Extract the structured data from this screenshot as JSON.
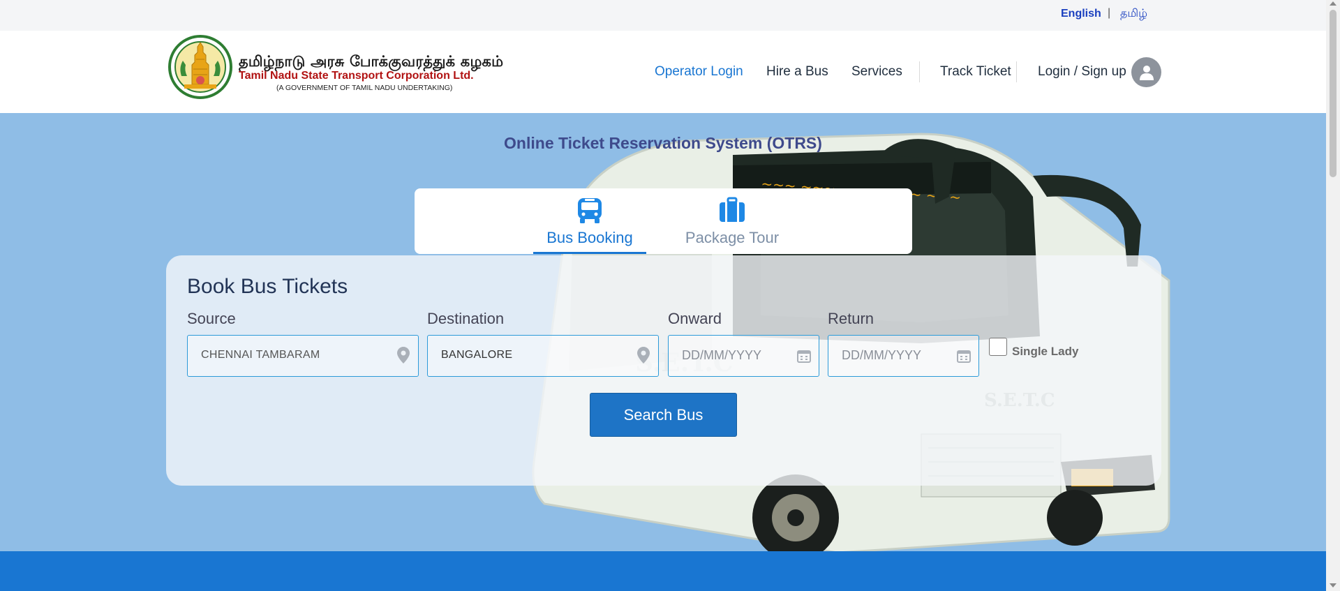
{
  "language_bar": {
    "english": "English",
    "separator": "|",
    "tamil": "தமிழ்"
  },
  "header": {
    "logo": {
      "tamil_name": "தமிழ்நாடு அரசு போக்குவரத்துக் கழகம்",
      "english_name": "Tamil Nadu State Transport Corporation Ltd.",
      "subtitle": "(A GOVERNMENT OF TAMIL NADU UNDERTAKING)"
    },
    "nav": {
      "operator_login": "Operator Login",
      "hire_a_bus": "Hire a Bus",
      "services": "Services",
      "track_ticket": "Track Ticket",
      "login_signup": "Login / Sign up"
    },
    "avatar_icon": "user-icon"
  },
  "hero": {
    "title": "Online Ticket Reservation System (OTRS)",
    "tabs": [
      {
        "label": "Bus Booking",
        "icon": "bus-icon",
        "active": true
      },
      {
        "label": "Package Tour",
        "icon": "suitcase-icon",
        "active": false
      }
    ],
    "booking": {
      "title": "Book Bus Tickets",
      "source_label": "Source",
      "source_value": "CHENNAI TAMBARAM",
      "destination_label": "Destination",
      "destination_value": "BANGALORE",
      "onward_label": "Onward",
      "onward_placeholder": "DD/MM/YYYY",
      "return_label": "Return",
      "return_placeholder": "DD/MM/YYYY",
      "single_lady_label": "Single Lady",
      "single_lady_checked": false,
      "search_button": "Search Bus"
    }
  },
  "colors": {
    "accent": "#1976d2",
    "hero_bg": "#8fbde6",
    "brand_red": "#b11212",
    "title_purple": "#3e4a8c"
  }
}
